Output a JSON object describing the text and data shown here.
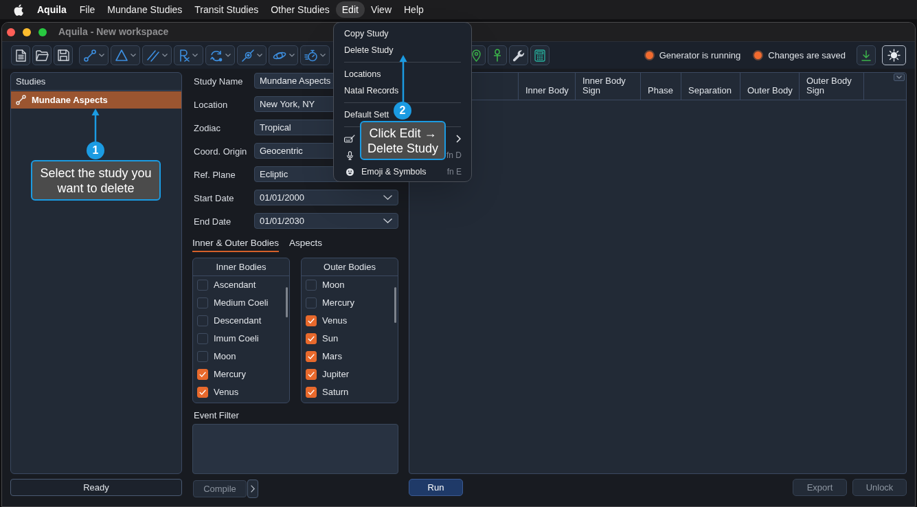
{
  "menu_bar": {
    "app_name": "Aquila",
    "items": [
      {
        "label": "File",
        "selected": false
      },
      {
        "label": "Mundane Studies",
        "selected": false
      },
      {
        "label": "Transit Studies",
        "selected": false
      },
      {
        "label": "Other Studies",
        "selected": false
      },
      {
        "label": "Edit",
        "selected": true
      },
      {
        "label": "View",
        "selected": false
      },
      {
        "label": "Help",
        "selected": false
      }
    ]
  },
  "window": {
    "title": "Aquila - New workspace"
  },
  "toolbar": {
    "status": [
      {
        "label": "Generator is running"
      },
      {
        "label": "Changes are saved"
      }
    ]
  },
  "studies": {
    "title": "Studies",
    "items": [
      {
        "label": "Mundane Aspects",
        "selected": true
      }
    ]
  },
  "form": {
    "fields": [
      {
        "label": "Study Name",
        "value": "Mundane Aspects",
        "kind": "text"
      },
      {
        "label": "Location",
        "value": "New York, NY",
        "kind": "text"
      },
      {
        "label": "Zodiac",
        "value": "Tropical",
        "kind": "text"
      },
      {
        "label": "Coord. Origin",
        "value": "Geocentric",
        "kind": "text"
      },
      {
        "label": "Ref. Plane",
        "value": "Ecliptic",
        "kind": "text"
      },
      {
        "label": "Start Date",
        "value": "01/01/2000",
        "kind": "date"
      },
      {
        "label": "End Date",
        "value": "01/01/2030",
        "kind": "date"
      }
    ]
  },
  "tabs": [
    {
      "label": "Inner & Outer Bodies",
      "selected": true
    },
    {
      "label": "Aspects",
      "selected": false
    }
  ],
  "body_lists": [
    {
      "title": "Inner Bodies",
      "items": [
        {
          "label": "Ascendant",
          "checked": false
        },
        {
          "label": "Medium Coeli",
          "checked": false
        },
        {
          "label": "Descendant",
          "checked": false
        },
        {
          "label": "Imum Coeli",
          "checked": false
        },
        {
          "label": "Moon",
          "checked": false
        },
        {
          "label": "Mercury",
          "checked": true
        },
        {
          "label": "Venus",
          "checked": true
        }
      ]
    },
    {
      "title": "Outer Bodies",
      "items": [
        {
          "label": "Moon",
          "checked": false
        },
        {
          "label": "Mercury",
          "checked": false
        },
        {
          "label": "Venus",
          "checked": true
        },
        {
          "label": "Sun",
          "checked": true
        },
        {
          "label": "Mars",
          "checked": true
        },
        {
          "label": "Jupiter",
          "checked": true
        },
        {
          "label": "Saturn",
          "checked": true
        }
      ]
    }
  ],
  "event_filter": {
    "label": "Event Filter"
  },
  "compile_button": {
    "label": "Compile",
    "disabled": true
  },
  "status_bar": {
    "text": "Ready"
  },
  "results_table": {
    "columns": [
      "Inner Body",
      "Inner Body Sign",
      "Phase",
      "Separation",
      "Outer Body",
      "Outer Body Sign"
    ]
  },
  "action_buttons": [
    {
      "label": "Run",
      "disabled": false
    },
    {
      "label": "Export",
      "disabled": true
    },
    {
      "label": "Unlock",
      "disabled": true
    }
  ],
  "edit_menu": {
    "groups": [
      {
        "items": [
          {
            "label": "Copy Study"
          },
          {
            "label": "Delete Study"
          }
        ]
      },
      {
        "items": [
          {
            "label": "Locations"
          },
          {
            "label": "Natal Records"
          }
        ]
      },
      {
        "items": [
          {
            "label": "Default Sett"
          }
        ]
      },
      {
        "items": [
          {
            "kind": "submenu"
          },
          {
            "kind": "shortcut",
            "shortcut": "fn D"
          },
          {
            "kind": "shortcut",
            "label": "Emoji & Symbols",
            "shortcut": "fn E"
          }
        ]
      }
    ]
  },
  "annotations": [
    {
      "number": "1",
      "text": "Select the study you want to delete"
    },
    {
      "number": "2",
      "text": "Click Edit → Delete Study"
    }
  ]
}
